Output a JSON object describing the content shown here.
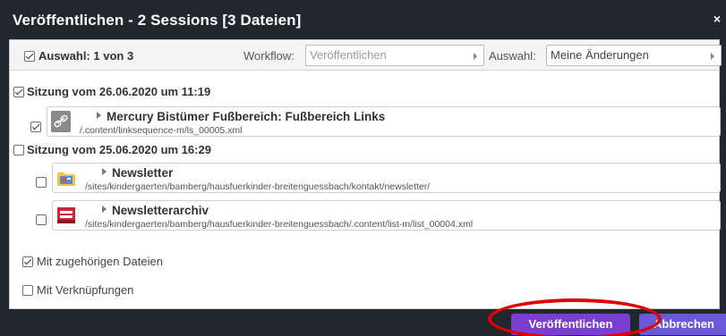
{
  "dialog": {
    "title": "Veröffentlichen - 2 Sessions [3 Dateien]",
    "close_glyph": "×"
  },
  "toolbar": {
    "select_all_label": "Auswahl: 1 von 3",
    "select_all_checked": true,
    "workflow_label": "Workflow:",
    "workflow_value": "Veröffentlichen",
    "selection_label": "Auswahl:",
    "selection_value": "Meine Änderungen"
  },
  "sessions": [
    {
      "label": "Sitzung vom 26.06.2020 um 11:19",
      "checked": true,
      "resources": [
        {
          "title": "Mercury Bistümer Fußbereich: Fußbereich Links",
          "path": "/.content/linksequence-m/ls_00005.xml",
          "checked": true,
          "icon": "link-icon"
        }
      ]
    },
    {
      "label": "Sitzung vom 25.06.2020 um 16:29",
      "checked": false,
      "resources": [
        {
          "title": "Newsletter",
          "path": "/sites/kindergaerten/bamberg/hausfuerkinder-breitenguessbach/kontakt/newsletter/",
          "checked": false,
          "icon": "folder-icon"
        },
        {
          "title": "Newsletterarchiv",
          "path": "/sites/kindergaerten/bamberg/hausfuerkinder-breitenguessbach/.content/list-m/list_00004.xml",
          "checked": false,
          "icon": "list-icon"
        }
      ]
    }
  ],
  "options": {
    "related_files_label": "Mit zugehörigen Dateien",
    "related_files_checked": true,
    "links_label": "Mit Verknüpfungen",
    "links_checked": false
  },
  "buttons": {
    "publish_label": "Veröffentlichen",
    "cancel_label": "Abbrechen"
  },
  "colors": {
    "publish_button": "#7a3fd0",
    "cancel_button": "#6a58d8",
    "highlight": "#e00000"
  }
}
